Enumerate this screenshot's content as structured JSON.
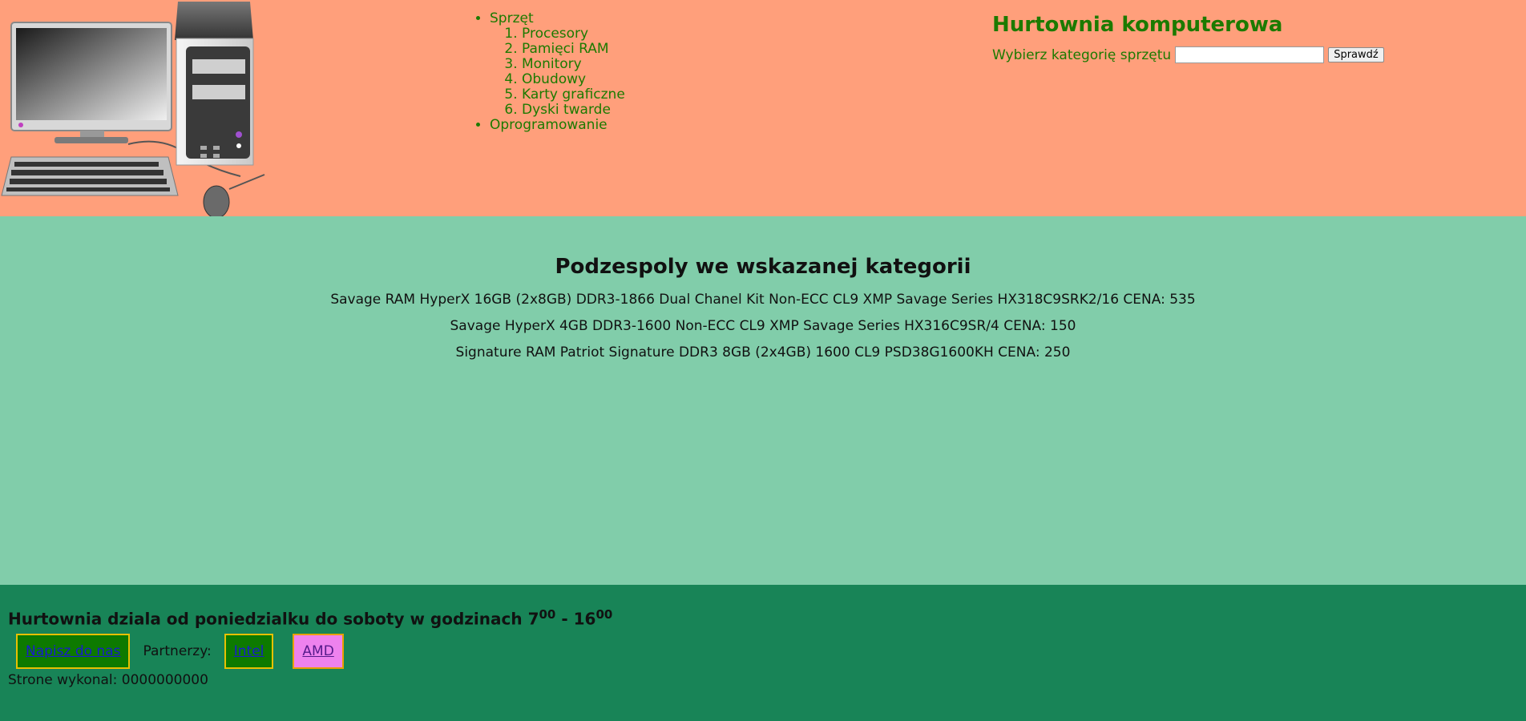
{
  "menu": {
    "sprzet": "Sprzęt",
    "items": [
      "Procesory",
      "Pamięci RAM",
      "Monitory",
      "Obudowy",
      "Karty graficzne",
      "Dyski twarde"
    ],
    "oprogramowanie": "Oprogramowanie"
  },
  "search": {
    "title": "Hurtownia komputerowa",
    "label": "Wybierz kategorię sprzętu",
    "value": "",
    "button": "Sprawdź"
  },
  "main": {
    "heading": "Podzespoly we wskazanej kategorii",
    "products": [
      "Savage RAM HyperX 16GB (2x8GB) DDR3-1866 Dual Chanel Kit Non-ECC CL9 XMP Savage Series HX318C9SRK2/16 CENA: 535",
      "Savage HyperX 4GB DDR3-1600 Non-ECC CL9 XMP Savage Series HX316C9SR/4 CENA: 150",
      "Signature RAM Patriot Signature DDR3 8GB (2x4GB) 1600 CL9 PSD38G1600KH CENA: 250"
    ]
  },
  "footer": {
    "hours_text": "Hurtownia dziala od poniedzialku do soboty w godzinach 7",
    "hours_from_sup": "00",
    "hours_sep": " - 16",
    "hours_to_sup": "00",
    "contact_link": "Napisz do nas",
    "partners_label": "Partnerzy:",
    "partner_intel": "Intel",
    "partner_amd": "AMD",
    "author": "Strone wykonal: 0000000000"
  },
  "colors": {
    "header_bg": "#ff9f7b",
    "main_bg": "#81cdaa",
    "footer_bg": "#188457",
    "accent_text": "#1c7a00"
  },
  "icons": {
    "logo": "desktop-computer-illustration"
  }
}
